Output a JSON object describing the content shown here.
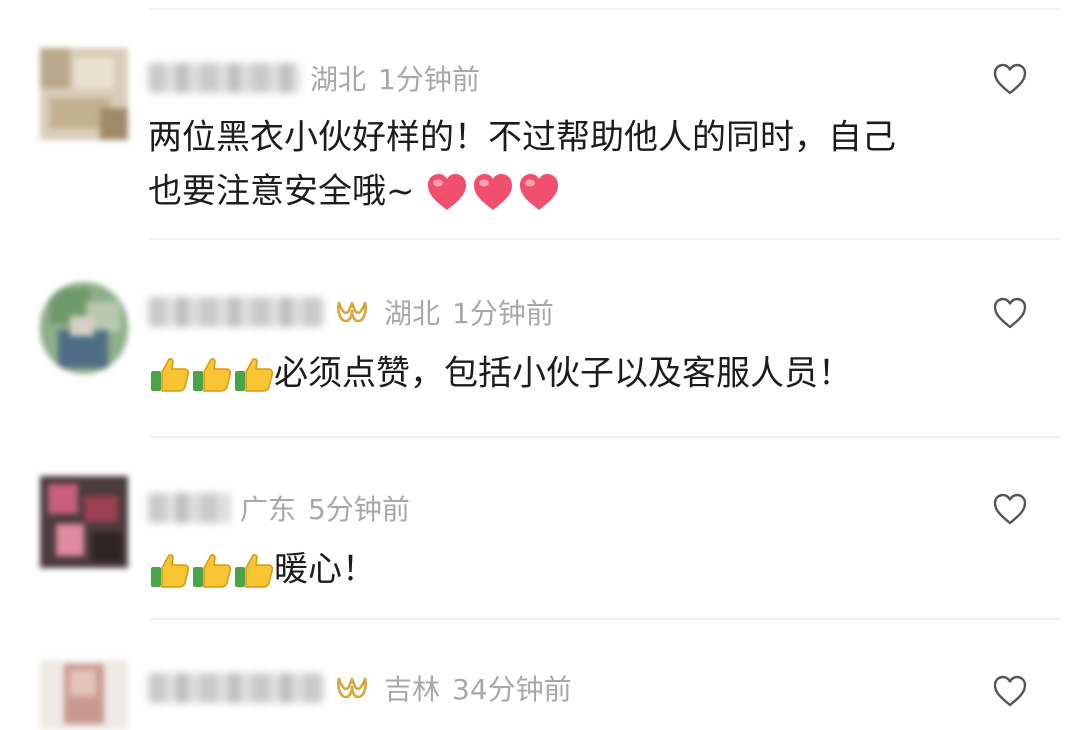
{
  "comments": [
    {
      "location": "湖北",
      "time": "1分钟前",
      "has_badge": false,
      "text": "两位黑衣小伙好样的！不过帮助他人的同时，自己",
      "text_line2": "也要注意安全哦~",
      "trailing_emoji": [
        "red-heart",
        "red-heart",
        "red-heart"
      ],
      "leading_emoji": []
    },
    {
      "location": "湖北",
      "time": "1分钟前",
      "has_badge": true,
      "text": "必须点赞，包括小伙子以及客服人员！",
      "leading_emoji": [
        "thumbs-up",
        "thumbs-up",
        "thumbs-up"
      ],
      "trailing_emoji": []
    },
    {
      "location": "广东",
      "time": "5分钟前",
      "has_badge": false,
      "text": "暖心！",
      "leading_emoji": [
        "thumbs-up",
        "thumbs-up",
        "thumbs-up"
      ],
      "trailing_emoji": []
    },
    {
      "location": "吉林",
      "time": "34分钟前",
      "has_badge": true,
      "text": "",
      "leading_emoji": [],
      "trailing_emoji": []
    }
  ],
  "icons": {
    "like": "heart-outline-icon",
    "badge": "gold-infinity-badge-icon"
  },
  "colors": {
    "meta_text": "#a8a8a8",
    "body_text": "#1c1c1c",
    "like_outline": "#555555",
    "badge_gold": "#d9a53c",
    "heart_emoji": "#f0506e",
    "thumb_emoji": "#f7c531"
  }
}
